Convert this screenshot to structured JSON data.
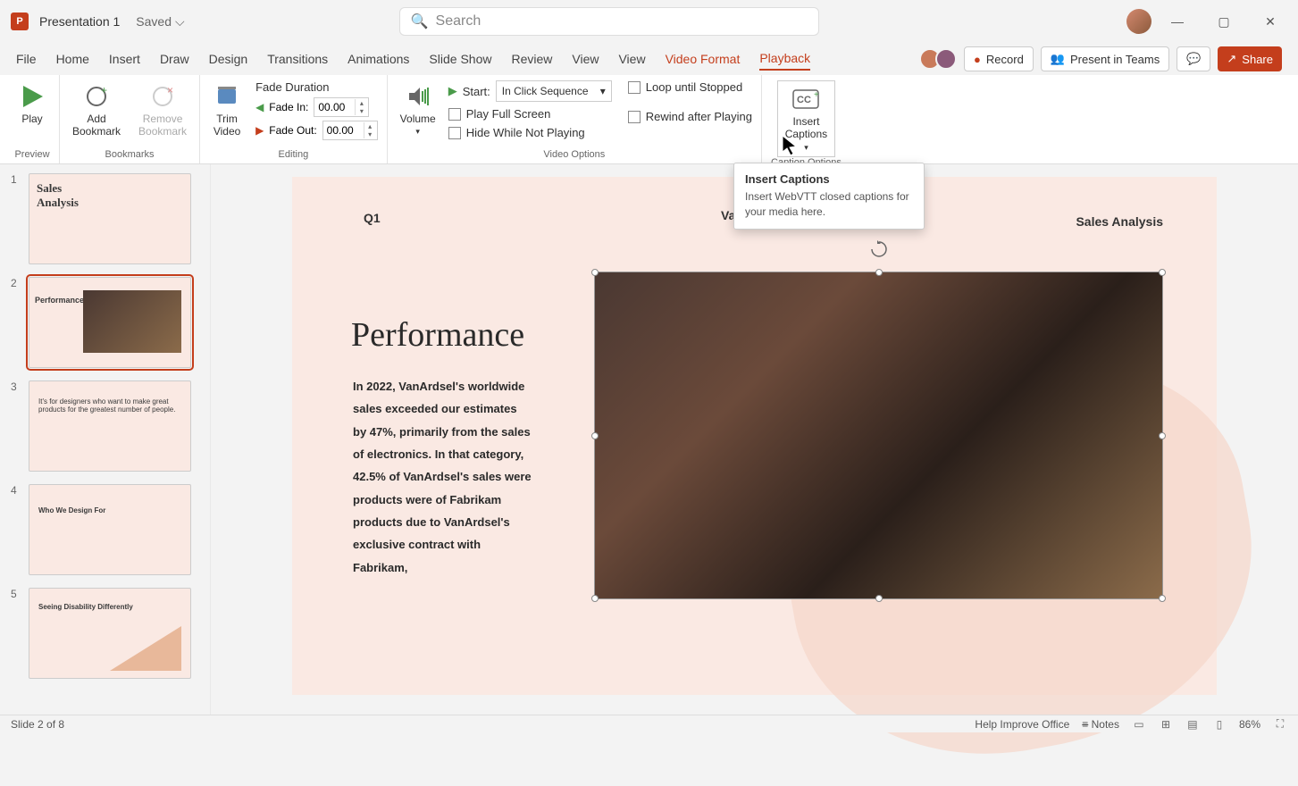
{
  "titlebar": {
    "app_letter": "P",
    "doc_title": "Presentation 1",
    "saved_status": "Saved",
    "search_placeholder": "Search"
  },
  "win_controls": {
    "min": "—",
    "max": "▢",
    "close": "✕"
  },
  "tabs": {
    "file": "File",
    "home": "Home",
    "insert": "Insert",
    "draw": "Draw",
    "design": "Design",
    "transitions": "Transitions",
    "animations": "Animations",
    "slideshow": "Slide Show",
    "review": "Review",
    "view": "View",
    "view2": "View",
    "videoformat": "Video Format",
    "playback": "Playback"
  },
  "tabrow_right": {
    "record": "Record",
    "present": "Present in Teams",
    "share": "Share"
  },
  "ribbon": {
    "preview": {
      "play": "Play",
      "label": "Preview"
    },
    "bookmarks": {
      "add": "Add\nBookmark",
      "remove": "Remove\nBookmark",
      "label": "Bookmarks"
    },
    "editing": {
      "trim": "Trim\nVideo",
      "fade_duration": "Fade Duration",
      "fade_in": "Fade In:",
      "fade_out": "Fade Out:",
      "fade_in_val": "00.00",
      "fade_out_val": "00.00",
      "label": "Editing"
    },
    "video_options": {
      "volume": "Volume",
      "start": "Start:",
      "start_val": "In Click Sequence",
      "play_full": "Play Full Screen",
      "hide": "Hide While Not Playing",
      "loop": "Loop until Stopped",
      "rewind": "Rewind after Playing",
      "label": "Video Options"
    },
    "captions": {
      "insert": "Insert\nCaptions",
      "label": "Caption Options"
    }
  },
  "tooltip": {
    "title": "Insert Captions",
    "body": "Insert WebVTT closed captions for your media here."
  },
  "thumbs": [
    {
      "num": "1",
      "title": "Sales\nAnalysis"
    },
    {
      "num": "2",
      "title": "Performance"
    },
    {
      "num": "3",
      "title": "It's for designers who want to make great products for the greatest number of people."
    },
    {
      "num": "4",
      "title": "Who We Design For"
    },
    {
      "num": "5",
      "title": "Seeing Disability Differently"
    }
  ],
  "slide": {
    "q1": "Q1",
    "brand": "VanArs",
    "sa": "Sales Analysis",
    "perf": "Performance",
    "body": "In 2022, VanArdsel's worldwide sales exceeded our estimates by 47%, primarily from the sales of electronics. In that category, 42.5% of VanArdsel's sales were products were of Fabrikam products due to VanArdsel's exclusive contract with Fabrikam,"
  },
  "statusbar": {
    "slide_info": "Slide 2 of 8",
    "help": "Help Improve Office",
    "notes": "Notes",
    "zoom": "86%"
  }
}
